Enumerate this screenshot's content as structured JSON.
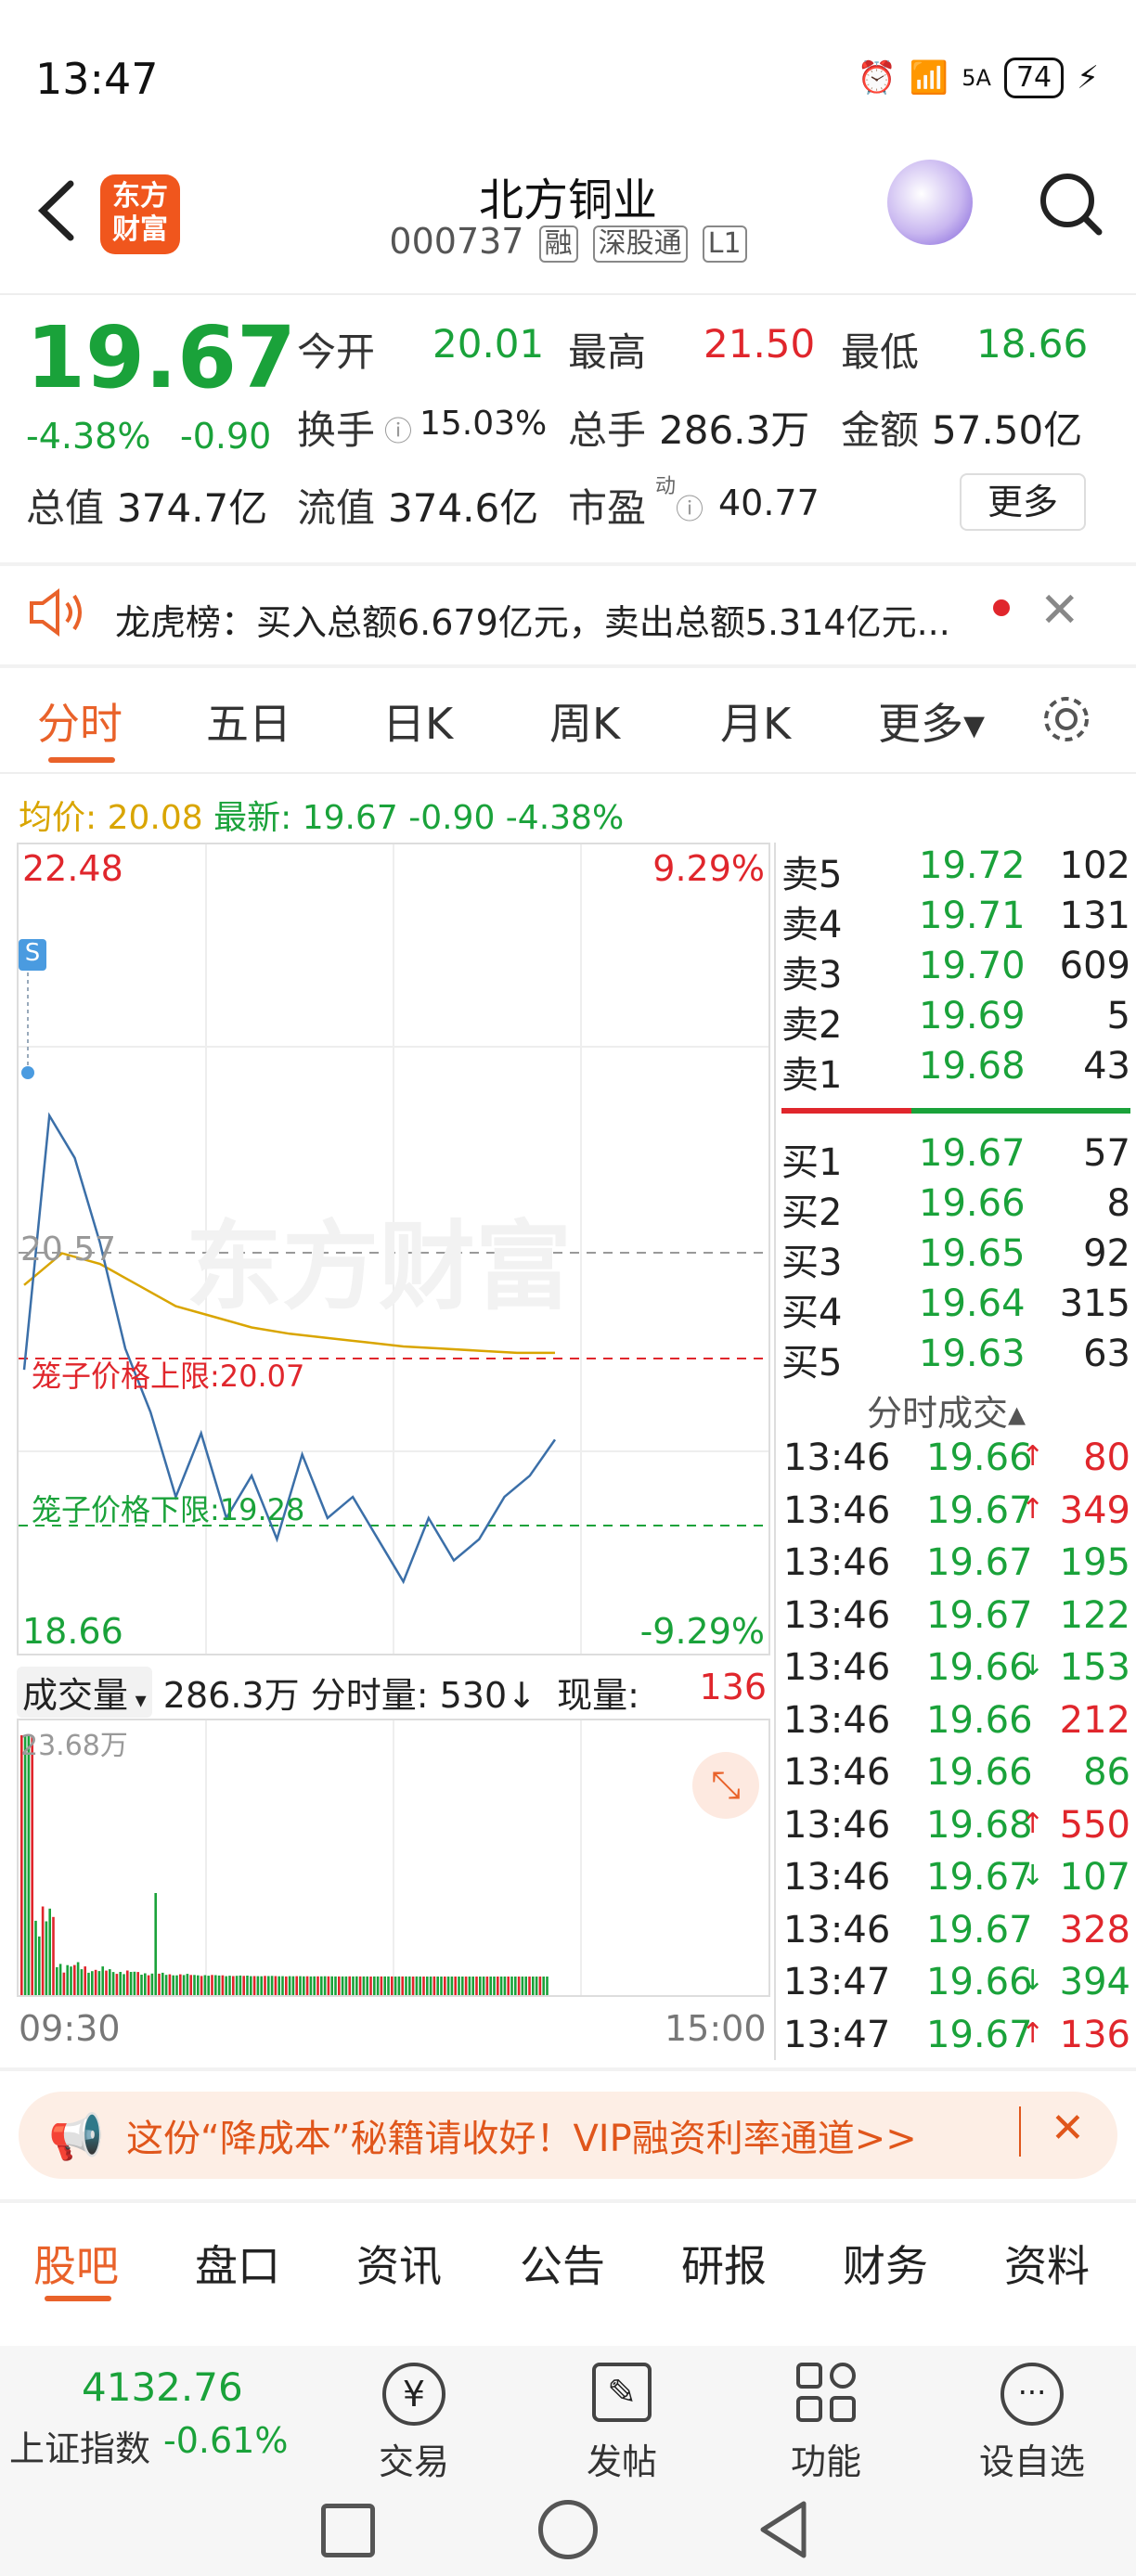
{
  "status": {
    "time": "13:47",
    "signal": "5A",
    "battery": "74"
  },
  "nav": {
    "back_icon": "chevron-left-icon",
    "logo_text": "东方财富",
    "title": "北方铜业",
    "code": "000737",
    "tags": [
      "融",
      "深股通",
      "L1"
    ],
    "search_icon": "search-icon"
  },
  "quote": {
    "price": "19.67",
    "change_pct": "-4.38%",
    "change": "-0.90",
    "open_label": "今开",
    "open": "20.01",
    "high_label": "最高",
    "high": "21.50",
    "low_label": "最低",
    "low": "18.66",
    "turnover_label": "换手",
    "turnover": "15.03%",
    "volume_label": "总手",
    "volume": "286.3万",
    "amount_label": "金额",
    "amount": "57.50亿",
    "mktcap_label": "总值",
    "mktcap": "374.7亿",
    "float_label": "流值",
    "float": "374.6亿",
    "pe_label": "市盈",
    "pe_sup": "动",
    "pe": "40.77",
    "more": "更多"
  },
  "news": {
    "text": "龙虎榜：买入总额6.679亿元，卖出总额5.314亿元..."
  },
  "tabs": [
    "分时",
    "五日",
    "日K",
    "周K",
    "月K",
    "更多▾"
  ],
  "avg_line": {
    "avg_label": "均价:",
    "avg": "20.08",
    "latest_label": "最新:",
    "latest": "19.67 -0.90 -4.38%"
  },
  "chart": {
    "max_price": "22.48",
    "min_price": "18.66",
    "max_pct": "9.29%",
    "min_pct": "-9.29%",
    "prev_close": "20.57",
    "upper_limit": "笼子价格上限:20.07",
    "lower_limit": "笼子价格下限:19.28",
    "watermark": "东方财富",
    "s_marker": "S",
    "vol_label": "成交量",
    "vol_total": "286.3万",
    "minute_vol_label": "分时量:",
    "minute_vol": "530↓",
    "now_vol_label": "现量:",
    "now_vol": "136",
    "vol_max": "23.68万",
    "time_start": "09:30",
    "time_end": "15:00"
  },
  "chart_data": {
    "type": "line",
    "x_range": [
      "09:30",
      "15:00"
    ],
    "ylim": [
      18.66,
      22.48
    ],
    "series": [
      {
        "name": "均价",
        "values": [
          20.4,
          20.55,
          20.5,
          20.4,
          20.3,
          20.25,
          20.2,
          20.17,
          20.15,
          20.13,
          20.11,
          20.1,
          20.09,
          20.08,
          20.08
        ]
      },
      {
        "values": [
          20.0,
          21.2,
          21.0,
          20.6,
          20.1,
          19.8,
          19.4,
          19.7,
          19.3,
          19.5,
          19.2,
          19.6,
          19.3,
          19.4,
          19.2,
          19.0,
          19.3,
          19.1,
          19.2,
          19.4,
          19.5,
          19.67
        ]
      }
    ]
  },
  "order_book": {
    "asks": [
      {
        "label": "卖5",
        "price": "19.72",
        "vol": "102"
      },
      {
        "label": "卖4",
        "price": "19.71",
        "vol": "131"
      },
      {
        "label": "卖3",
        "price": "19.70",
        "vol": "609"
      },
      {
        "label": "卖2",
        "price": "19.69",
        "vol": "5"
      },
      {
        "label": "卖1",
        "price": "19.68",
        "vol": "43"
      }
    ],
    "bids": [
      {
        "label": "买1",
        "price": "19.67",
        "vol": "57"
      },
      {
        "label": "买2",
        "price": "19.66",
        "vol": "8"
      },
      {
        "label": "买3",
        "price": "19.65",
        "vol": "92"
      },
      {
        "label": "买4",
        "price": "19.64",
        "vol": "315"
      },
      {
        "label": "买5",
        "price": "19.63",
        "vol": "63"
      }
    ],
    "trades_title": "分时成交▴",
    "trades": [
      {
        "time": "13:46",
        "price": "19.66",
        "arrow": "↑",
        "vol": "80",
        "color": "red"
      },
      {
        "time": "13:46",
        "price": "19.67",
        "arrow": "↑",
        "vol": "349",
        "color": "red"
      },
      {
        "time": "13:46",
        "price": "19.67",
        "arrow": "",
        "vol": "195",
        "color": "green"
      },
      {
        "time": "13:46",
        "price": "19.67",
        "arrow": "",
        "vol": "122",
        "color": "green"
      },
      {
        "time": "13:46",
        "price": "19.66",
        "arrow": "↓",
        "vol": "153",
        "color": "green"
      },
      {
        "time": "13:46",
        "price": "19.66",
        "arrow": "",
        "vol": "212",
        "color": "red"
      },
      {
        "time": "13:46",
        "price": "19.66",
        "arrow": "",
        "vol": "86",
        "color": "green"
      },
      {
        "time": "13:46",
        "price": "19.68",
        "arrow": "↑",
        "vol": "550",
        "color": "red"
      },
      {
        "time": "13:46",
        "price": "19.67",
        "arrow": "↓",
        "vol": "107",
        "color": "green"
      },
      {
        "time": "13:46",
        "price": "19.67",
        "arrow": "",
        "vol": "328",
        "color": "red"
      },
      {
        "time": "13:47",
        "price": "19.66",
        "arrow": "↓",
        "vol": "394",
        "color": "green"
      },
      {
        "time": "13:47",
        "price": "19.67",
        "arrow": "↑",
        "vol": "136",
        "color": "red"
      }
    ]
  },
  "promo": {
    "text": "这份“降成本”秘籍请收好！VIP融资利率通道>>"
  },
  "bottom_tabs": [
    "股吧",
    "盘口",
    "资讯",
    "公告",
    "研报",
    "财务",
    "资料"
  ],
  "bottom_nav": {
    "index_value": "4132.76",
    "index_name": "上证指数",
    "index_change": "-0.61%",
    "items": [
      "交易",
      "发帖",
      "功能",
      "设自选"
    ]
  },
  "colors": {
    "up": "#e0262c",
    "down": "#1aa23a",
    "accent": "#e9622a",
    "avg": "#d9a500"
  }
}
